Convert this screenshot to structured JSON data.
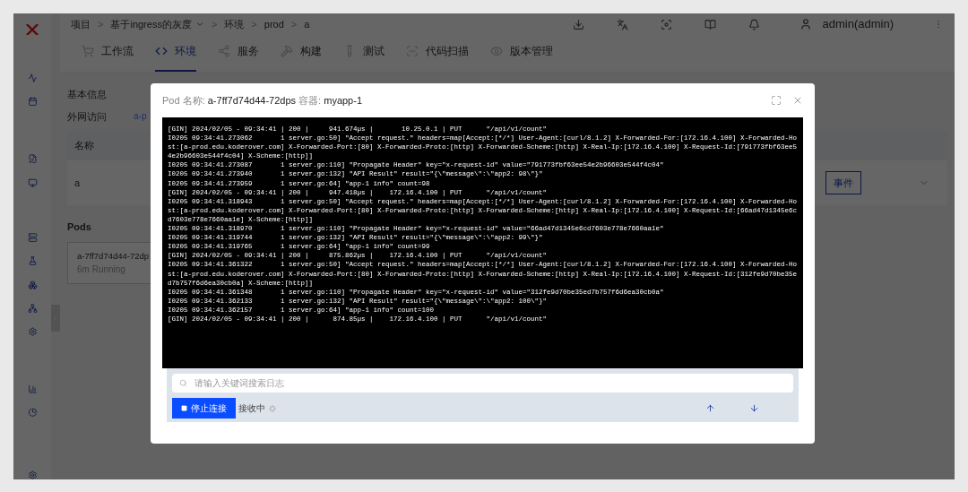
{
  "breadcrumb": [
    {
      "label": "项目",
      "dropdown": false
    },
    {
      "separator": ">",
      "label": "基于ingress的灰度",
      "dropdown": true
    },
    {
      "separator": ">",
      "label": "环境",
      "dropdown": false
    },
    {
      "separator": ">",
      "label": "prod",
      "dropdown": false
    },
    {
      "separator": ">",
      "label": "a",
      "dropdown": false
    }
  ],
  "user": {
    "name": "admin(admin)"
  },
  "tabs": [
    {
      "label": "工作流",
      "selected": false
    },
    {
      "label": "环境",
      "selected": true
    },
    {
      "label": "服务",
      "selected": false
    },
    {
      "label": "构建",
      "selected": false
    },
    {
      "label": "测试",
      "selected": false
    },
    {
      "label": "代码扫描",
      "selected": false
    },
    {
      "label": "版本管理",
      "selected": false
    }
  ],
  "section_title": "基本信息",
  "access": {
    "label": "外网访问",
    "value": "a-p"
  },
  "table": {
    "columns": [
      "名称"
    ],
    "rows": [
      {
        "name": "a",
        "action": "事件"
      }
    ]
  },
  "pods": {
    "title": "Pods",
    "items": [
      {
        "name": "a-7ff7d74d44-72dp",
        "status": "6m Running"
      }
    ]
  },
  "modal": {
    "pod_label": "Pod 名称:",
    "pod_name": "a-7ff7d74d44-72dps",
    "container_label": "容器:",
    "container_name": "myapp-1",
    "log_lines": [
      "[GIN] 2024/02/05 - 09:34:41 | 200 |     941.674µs |       10.25.0.1 | PUT      \"/api/v1/count\"",
      "I0205 09:34:41.273062       1 server.go:50] \"Accept request.\" headers=map[Accept:[*/*] User-Agent:[curl/8.1.2] X-Forwarded-For:[172.16.4.100] X-Forwarded-Host:[a-prod.edu.koderover.com] X-Forwarded-Port:[80] X-Forwarded-Proto:[http] X-Forwarded-Scheme:[http] X-Real-Ip:[172.16.4.100] X-Request-Id:[791773fbf63ee54e2b96603e544f4c04] X-Scheme:[http]]",
      "I0205 09:34:41.273087       1 server.go:110] \"Propagate Header\" key=\"x-request-id\" value=\"791773fbf63ee54e2b96603e544f4c04\"",
      "I0205 09:34:41.273940       1 server.go:132] \"API Result\" result=\"{\\\"message\\\":\\\"app2: 98\\\"}\"",
      "I0205 09:34:41.273959       1 server.go:64] \"app-1 info\" count=98",
      "[GIN] 2024/02/05 - 09:34:41 | 200 |     947.418µs |    172.16.4.100 | PUT      \"/api/v1/count\"",
      "I0205 09:34:41.318943       1 server.go:50] \"Accept request.\" headers=map[Accept:[*/*] User-Agent:[curl/8.1.2] X-Forwarded-For:[172.16.4.100] X-Forwarded-Host:[a-prod.edu.koderover.com] X-Forwarded-Port:[80] X-Forwarded-Proto:[http] X-Forwarded-Scheme:[http] X-Real-Ip:[172.16.4.100] X-Request-Id:[66ad47d1345e6cd7603e778e7660aa1e] X-Scheme:[http]]",
      "I0205 09:34:41.318970       1 server.go:110] \"Propagate Header\" key=\"x-request-id\" value=\"66ad47d1345e6cd7603e778e7660aa1e\"",
      "I0205 09:34:41.319744       1 server.go:132] \"API Result\" result=\"{\\\"message\\\":\\\"app2: 99\\\"}\"",
      "I0205 09:34:41.319765       1 server.go:64] \"app-1 info\" count=99",
      "[GIN] 2024/02/05 - 09:34:41 | 200 |     875.862µs |    172.16.4.100 | PUT      \"/api/v1/count\"",
      "I0205 09:34:41.361322       1 server.go:50] \"Accept request.\" headers=map[Accept:[*/*] User-Agent:[curl/8.1.2] X-Forwarded-For:[172.16.4.100] X-Forwarded-Host:[a-prod.edu.koderover.com] X-Forwarded-Port:[80] X-Forwarded-Proto:[http] X-Forwarded-Scheme:[http] X-Real-Ip:[172.16.4.100] X-Request-Id:[312fe9d70be35ed7b757f6d6ea30cb0a] X-Scheme:[http]]",
      "I0205 09:34:41.361348       1 server.go:110] \"Propagate Header\" key=\"x-request-id\" value=\"312fe9d70be35ed7b757f6d6ea30cb0a\"",
      "I0205 09:34:41.362133       1 server.go:132] \"API Result\" result=\"{\\\"message\\\":\\\"app2: 100\\\"}\"",
      "I0205 09:34:41.362157       1 server.go:64] \"app-1 info\" count=100",
      "[GIN] 2024/02/05 - 09:34:41 | 200 |      874.85µs |    172.16.4.100 | PUT      \"/api/v1/count\""
    ],
    "search": {
      "placeholder": "请输入关键词搜索日志"
    },
    "stop_button": "停止连接",
    "status": "接收中"
  }
}
